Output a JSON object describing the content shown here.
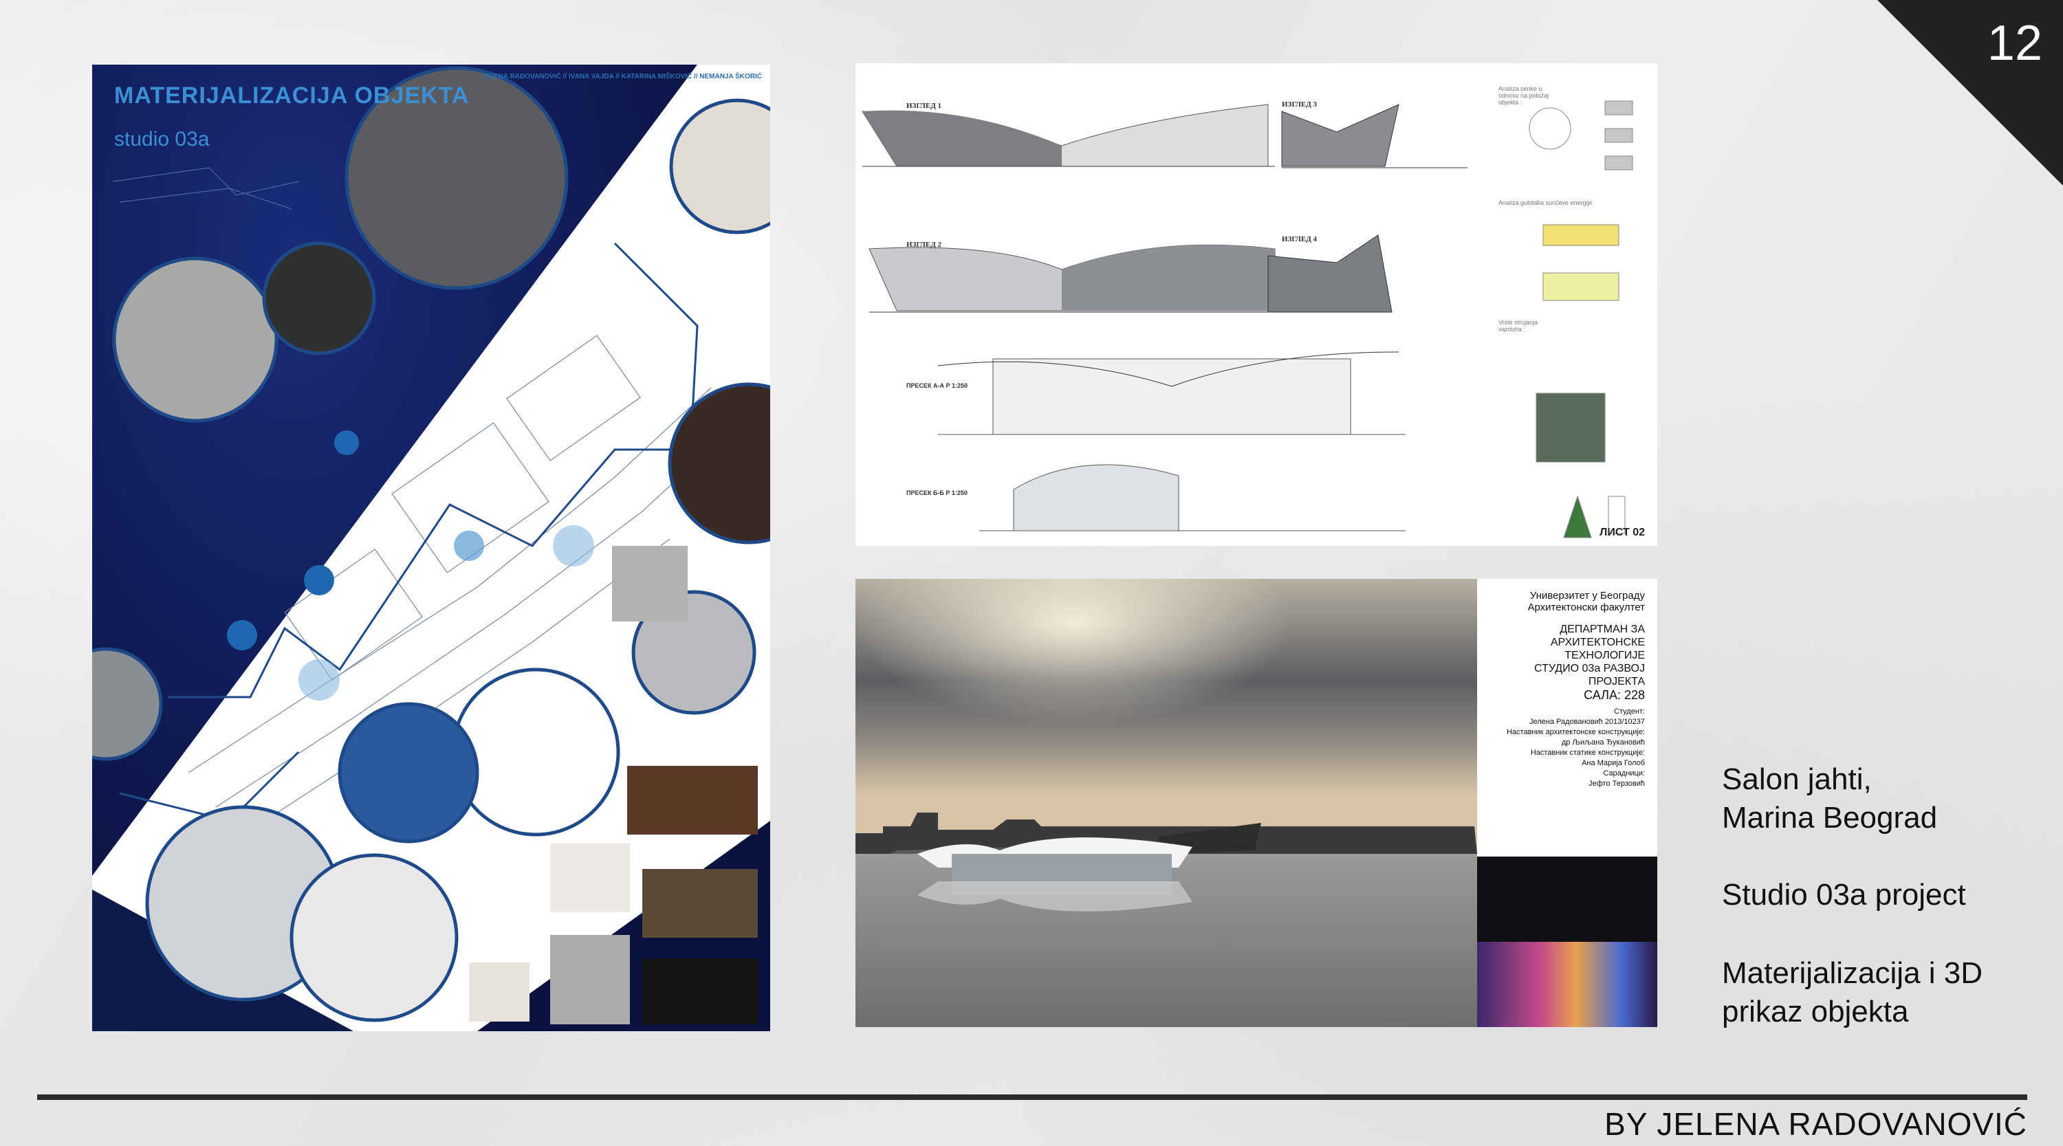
{
  "page_number": "12",
  "poster1": {
    "title": "MATERIJALIZACIJA OBJEKTA",
    "subtitle": "studio 03a",
    "authors": "JELENA RADOVANOVIĆ // IVANA VAJDA // KATARINA MIŠKOVIĆ // NEMANJA ŠKORIĆ"
  },
  "poster2": {
    "elev1": "ИЗГЛЕД 1",
    "elev2": "ИЗГЛЕД 2",
    "elev3": "ИЗГЛЕД 3",
    "elev4": "ИЗГЛЕД 4",
    "section_a": "ПРЕСЕК А-А Р 1:250",
    "section_b": "ПРЕСЕК Б-Б Р 1:250",
    "sheet": "ЛИСТ 02",
    "analysis1": "Analiza senke u odnosu na položaj objekta :",
    "analysis2": "Analiza gubitaka sunčeve energije",
    "analysis3": "Vrste strujanja vazduha :"
  },
  "poster3": {
    "university": "Универзитет у Београду",
    "faculty": "Архитектонски факултет",
    "dept1": "ДЕПАРТМАН ЗА",
    "dept2": "АРХИТЕКТОНСКЕ ТЕХНОЛОГИЈЕ",
    "dept3": "СТУДИО 03а РАЗВОЈ ПРОЈЕКТА",
    "room": "САЛА: 228",
    "student_label": "Студент:",
    "student": "Јелена Радовановић 2013/10237",
    "teacher1_label": "Наставник архитектонске конструкције:",
    "teacher1": "др Љиљана Ђукановић",
    "teacher2_label": "Наставник статике конструкције:",
    "teacher2": "Ана Марија Голоб",
    "assistant_label": "Сарадници:",
    "assistant": "Јефто Терзовић"
  },
  "description": {
    "line1": "Salon jahti,",
    "line2": "Marina Beograd",
    "line3": "Studio 03a project",
    "line4": "Materijalizacija i 3D",
    "line5": "prikaz objekta"
  },
  "byline": "BY  JELENA RADOVANOVIĆ"
}
